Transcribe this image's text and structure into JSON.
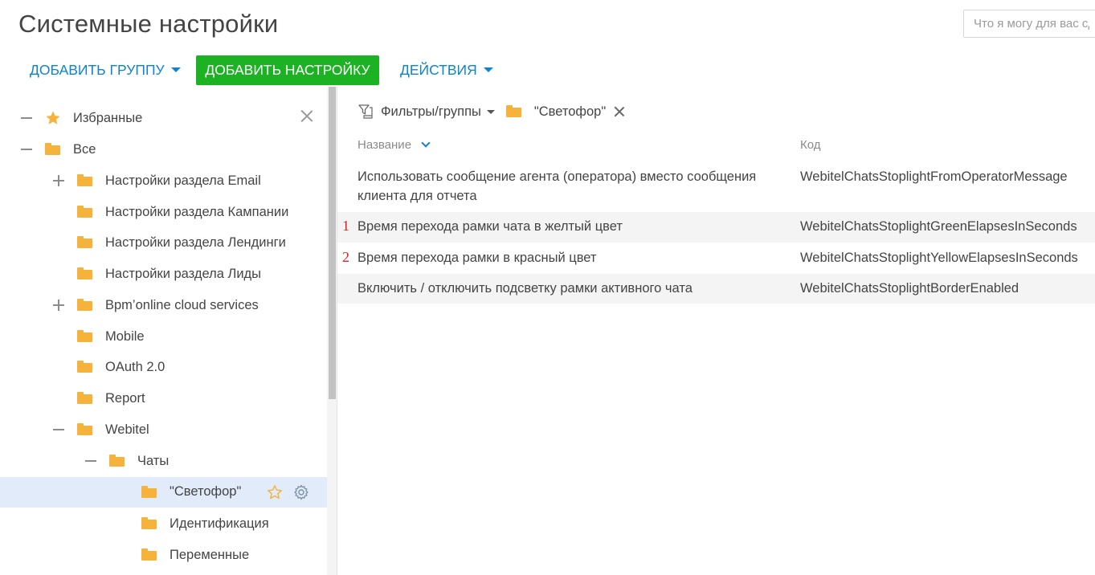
{
  "page": {
    "title": "Системные настройки",
    "search_placeholder": "Что я могу для вас сделать?"
  },
  "toolbar": {
    "add_group_label": "ДОБАВИТЬ ГРУППУ",
    "add_setting_label": "ДОБАВИТЬ НАСТРОЙКУ",
    "actions_label": "ДЕЙСТВИЯ"
  },
  "tree": {
    "items": [
      {
        "label": "Избранные",
        "icon": "star-icon",
        "toggle": "minus",
        "level": 0
      },
      {
        "label": "Все",
        "icon": "folder-icon",
        "toggle": "minus",
        "level": 0
      },
      {
        "label": "Настройки раздела Email",
        "icon": "folder-icon",
        "toggle": "plus",
        "level": 1
      },
      {
        "label": "Настройки раздела Кампании",
        "icon": "folder-icon",
        "toggle": "none",
        "level": 1
      },
      {
        "label": "Настройки раздела Лендинги",
        "icon": "folder-icon",
        "toggle": "none",
        "level": 1
      },
      {
        "label": "Настройки раздела Лиды",
        "icon": "folder-icon",
        "toggle": "none",
        "level": 1
      },
      {
        "label": "Bpm’online cloud services",
        "icon": "folder-icon",
        "toggle": "plus",
        "level": 1
      },
      {
        "label": "Mobile",
        "icon": "folder-icon",
        "toggle": "none",
        "level": 1
      },
      {
        "label": "OAuth 2.0",
        "icon": "folder-icon",
        "toggle": "none",
        "level": 1
      },
      {
        "label": "Report",
        "icon": "folder-icon",
        "toggle": "none",
        "level": 1
      },
      {
        "label": "Webitel",
        "icon": "folder-icon",
        "toggle": "minus",
        "level": 1
      },
      {
        "label": "Чаты",
        "icon": "folder-icon",
        "toggle": "minus",
        "level": 2
      },
      {
        "label": "\"Светофор\"",
        "icon": "folder-icon",
        "toggle": "none",
        "level": 3,
        "selected": true
      },
      {
        "label": "Идентификация",
        "icon": "folder-icon",
        "toggle": "none",
        "level": 3
      },
      {
        "label": "Переменные",
        "icon": "folder-icon",
        "toggle": "none",
        "level": 3
      }
    ]
  },
  "filter": {
    "filters_label": "Фильтры/группы",
    "active_group": "\"Светофор\""
  },
  "grid": {
    "columns": [
      "Название",
      "Код"
    ],
    "rows": [
      {
        "marker": "",
        "name": "Использовать сообщение агента (оператора) вместо сообщения клиента для отчета",
        "code": "WebitelChatsStoplightFromOperatorMessage"
      },
      {
        "marker": "1",
        "name": "Время перехода рамки чата в желтый цвет",
        "code": "WebitelChatsStoplightGreenElapsesInSeconds"
      },
      {
        "marker": "2",
        "name": "Время перехода рамки в красный цвет",
        "code": "WebitelChatsStoplightYellowElapsesInSeconds"
      },
      {
        "marker": "",
        "name": "Включить / отключить подсветку рамки активного чата",
        "code": "WebitelChatsStoplightBorderEnabled"
      }
    ]
  },
  "colors": {
    "accent_blue": "#0d84ce",
    "button_green": "#1db124",
    "folder_yellow": "#f5b33b",
    "selected_row": "#e1ebf9",
    "marker_red": "#e02020"
  }
}
